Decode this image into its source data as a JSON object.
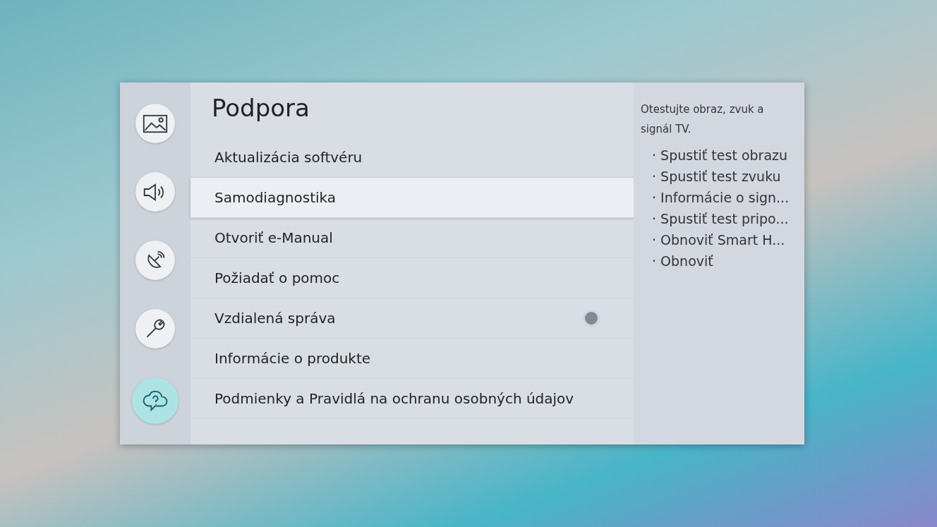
{
  "sidebar": {
    "items": [
      {
        "kind": "picture",
        "selected": false
      },
      {
        "kind": "sound",
        "selected": false
      },
      {
        "kind": "broadcast",
        "selected": false
      },
      {
        "kind": "general",
        "selected": false
      },
      {
        "kind": "support",
        "selected": true
      }
    ]
  },
  "title": "Podpora",
  "menu": [
    {
      "label": "Aktualizácia softvéru",
      "selected": false
    },
    {
      "label": "Samodiagnostika",
      "selected": true
    },
    {
      "label": "Otvoriť e-Manual",
      "selected": false
    },
    {
      "label": "Požiadať o pomoc",
      "selected": false
    },
    {
      "label": "Vzdialená správa",
      "selected": false,
      "toggle": {
        "on": false
      }
    },
    {
      "label": "Informácie o produkte",
      "selected": false
    },
    {
      "label": "Podmienky a Pravidlá na ochranu osobných údajov",
      "selected": false
    }
  ],
  "info": {
    "description": "Otestujte obraz, zvuk a signál TV.",
    "items": [
      "· Spustiť test obrazu",
      "· Spustiť test zvuku",
      "· Informácie o sign...",
      "· Spustiť test pripo...",
      "· Obnoviť Smart H...",
      "· Obnoviť"
    ]
  }
}
